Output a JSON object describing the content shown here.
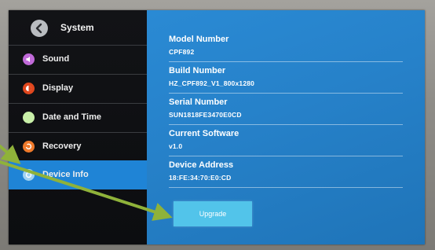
{
  "sidebar": {
    "title": "System",
    "items": [
      {
        "label": "Sound",
        "icon": "sound-icon",
        "color": "#c06ad8"
      },
      {
        "label": "Display",
        "icon": "display-icon",
        "color": "#e0471e"
      },
      {
        "label": "Date and Time",
        "icon": "clock-icon",
        "color": "#c8efa8"
      },
      {
        "label": "Recovery",
        "icon": "recovery-icon",
        "color": "#ef7a2b"
      },
      {
        "label": "Device Info",
        "icon": "info-icon",
        "color": "#9fd2f2",
        "active": true
      }
    ]
  },
  "device_info": {
    "model_number": {
      "label": "Model Number",
      "value": "CPF892"
    },
    "build_number": {
      "label": "Build Number",
      "value": "HZ_CPF892_V1_800x1280"
    },
    "serial_number": {
      "label": "Serial Number",
      "value": "SUN1818FE3470E0CD"
    },
    "current_software": {
      "label": "Current Software",
      "value": "v1.0"
    },
    "device_address": {
      "label": "Device Address",
      "value": "18:FE:34:70:E0:CD"
    }
  },
  "upgrade_label": "Upgrade",
  "colors": {
    "accent": "#1f84d6",
    "content_bg": "#2681c9",
    "button": "#52c4ea",
    "annotation_arrow": "#8fb23a"
  }
}
